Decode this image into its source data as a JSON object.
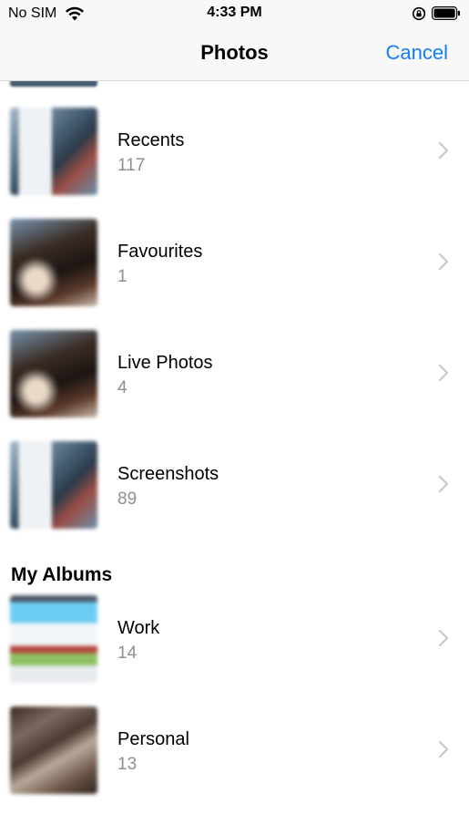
{
  "status_bar": {
    "carrier": "No SIM",
    "time": "4:33 PM"
  },
  "nav": {
    "title": "Photos",
    "cancel_label": "Cancel"
  },
  "albums": [
    {
      "name": "Recents",
      "count": "117",
      "thumb": "screenshot"
    },
    {
      "name": "Favourites",
      "count": "1",
      "thumb": "photo"
    },
    {
      "name": "Live Photos",
      "count": "4",
      "thumb": "photo"
    },
    {
      "name": "Screenshots",
      "count": "89",
      "thumb": "screenshot"
    }
  ],
  "my_albums": {
    "header": "My Albums",
    "items": [
      {
        "name": "Work",
        "count": "14",
        "thumb": "work"
      },
      {
        "name": "Personal",
        "count": "13",
        "thumb": "personal"
      }
    ]
  },
  "colors": {
    "accent": "#147efb",
    "secondary_text": "#8e8e93",
    "chevron": "#c7c7cc"
  },
  "icons": {
    "wifi": "wifi-icon",
    "orientation_lock": "orientation-lock-icon",
    "battery": "battery-icon",
    "chevron": "chevron-right-icon"
  }
}
